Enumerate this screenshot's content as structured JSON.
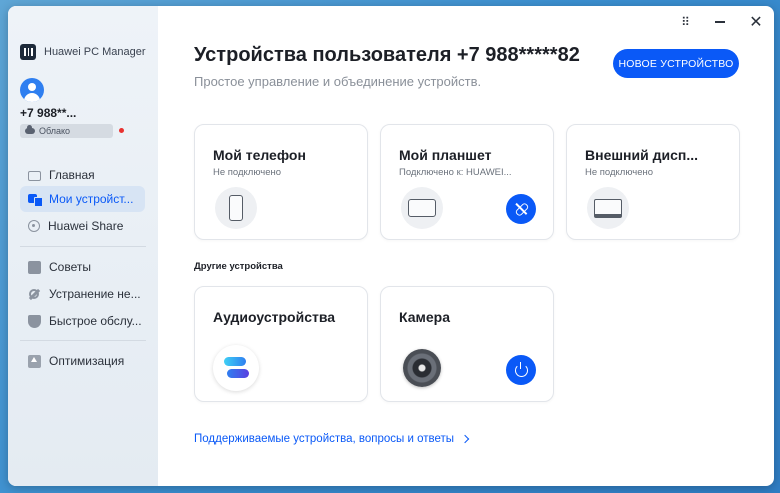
{
  "app": {
    "name": "Huawei PC Manager"
  },
  "account": {
    "phone": "+7 988**...",
    "cloud_label": "Облако"
  },
  "sidebar": {
    "items": [
      {
        "label": "Главная",
        "icon": "home-icon"
      },
      {
        "label": "Мои устройст...",
        "icon": "devices-icon"
      },
      {
        "label": "Huawei Share",
        "icon": "share-icon"
      },
      {
        "label": "Советы",
        "icon": "tips-icon"
      },
      {
        "label": "Устранение не...",
        "icon": "tools-icon"
      },
      {
        "label": "Быстрое обслу...",
        "icon": "shield-icon"
      },
      {
        "label": "Оптимизация",
        "icon": "optimize-icon"
      }
    ],
    "active_index": 1
  },
  "window_controls": {
    "pin_glyph": "⠿",
    "close_glyph": "✕"
  },
  "header": {
    "title": "Устройства пользователя +7 988*****82",
    "subtitle": "Простое управление и объединение устройств.",
    "new_device_button": "НОВОЕ УСТРОЙСТВО"
  },
  "my_devices": [
    {
      "title": "Мой телефон",
      "status": "Не подключено"
    },
    {
      "title": "Мой планшет",
      "status": "Подключено к: HUAWEI..."
    },
    {
      "title": "Внешний дисп...",
      "status": "Не подключено"
    }
  ],
  "other_devices": {
    "section_label": "Другие устройства",
    "items": [
      {
        "title": "Аудиоустройства"
      },
      {
        "title": "Камера"
      }
    ]
  },
  "footer": {
    "link": "Поддерживаемые устройства, вопросы и ответы"
  },
  "colors": {
    "accent": "#0a59f7",
    "sidebar_bg": "#eef3f8",
    "status_dot": "#e8312f"
  }
}
